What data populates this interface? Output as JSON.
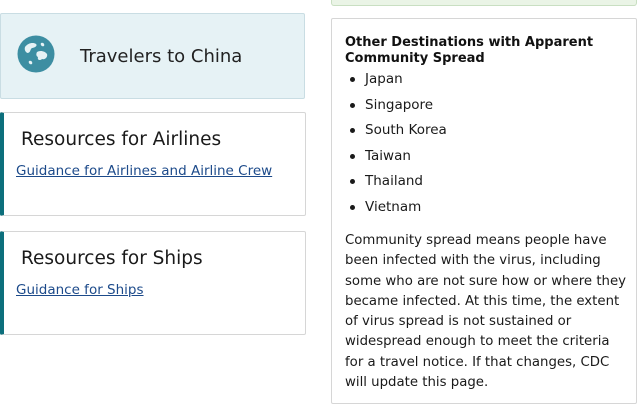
{
  "travelers": {
    "title": "Travelers to China",
    "icon": "globe-icon"
  },
  "airlines": {
    "title": "Resources for Airlines",
    "link": "Guidance for Airlines and Airline Crew"
  },
  "ships": {
    "title": "Resources for Ships",
    "link": "Guidance for Ships"
  },
  "destinations": {
    "heading": "Other Destinations with Apparent Community Spread",
    "items": [
      "Japan",
      "Singapore",
      "South Korea",
      "Taiwan",
      "Thailand",
      "Vietnam"
    ],
    "paragraph": "Community spread means people have been infected with the virus, including some who are not sure how or where they became infected. At this time, the extent of virus spread is not sustained or widespread enough to meet the criteria for a travel notice. If that changes, CDC will update this page."
  },
  "colors": {
    "accent": "#0d6f7c",
    "travel_card_bg": "#e6f2f5",
    "link": "#1c4a8a",
    "globe": "#3d8ea2"
  }
}
